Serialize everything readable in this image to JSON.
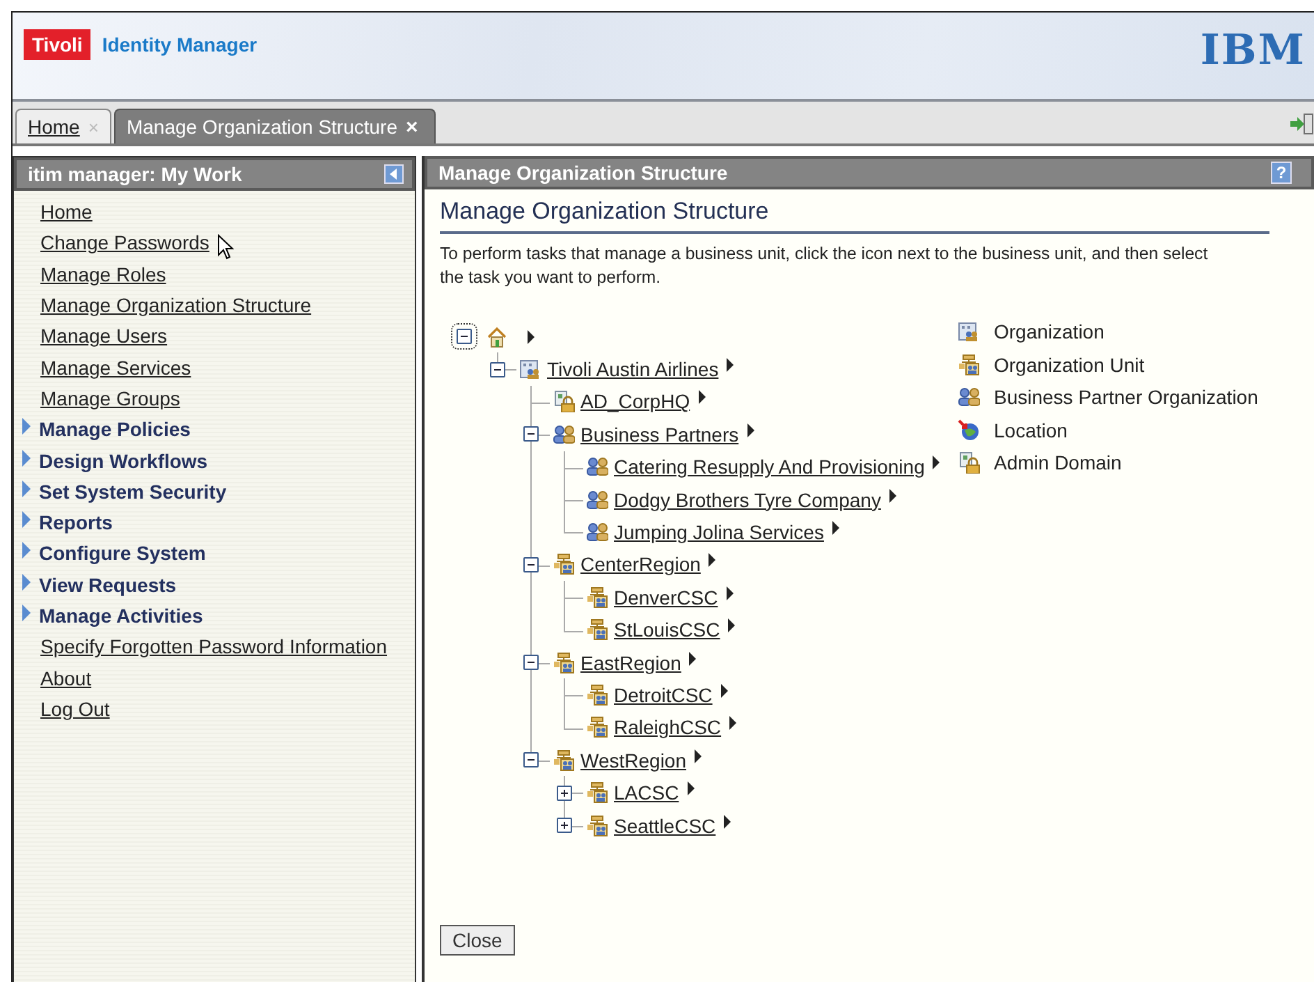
{
  "header": {
    "brand": "Tivoli",
    "product": "Identity Manager",
    "logo": "IBM"
  },
  "tabs": [
    {
      "label": "Home",
      "close": "×",
      "selected": false
    },
    {
      "label": "Manage Organization Structure",
      "close": "×",
      "selected": true
    }
  ],
  "sidebar": {
    "title": "itim manager: My Work",
    "items": [
      {
        "label": "Home",
        "kind": "link"
      },
      {
        "label": "Change Passwords",
        "kind": "link",
        "hovered": true
      },
      {
        "label": "Manage Roles",
        "kind": "link"
      },
      {
        "label": "Manage Organization Structure",
        "kind": "link"
      },
      {
        "label": "Manage Users",
        "kind": "link"
      },
      {
        "label": "Manage Services",
        "kind": "link"
      },
      {
        "label": "Manage Groups",
        "kind": "link"
      },
      {
        "label": "Manage Policies",
        "kind": "group",
        "expanded": false
      },
      {
        "label": "Design Workflows",
        "kind": "group",
        "expanded": false
      },
      {
        "label": "Set System Security",
        "kind": "group",
        "expanded": false
      },
      {
        "label": "Reports",
        "kind": "group",
        "expanded": false
      },
      {
        "label": "Configure System",
        "kind": "group",
        "expanded": false
      },
      {
        "label": "View Requests",
        "kind": "group",
        "expanded": false
      },
      {
        "label": "Manage Activities",
        "kind": "group",
        "expanded": false
      },
      {
        "label": "Specify Forgotten Password Information",
        "kind": "link"
      },
      {
        "label": "About",
        "kind": "link"
      },
      {
        "label": "Log Out",
        "kind": "link"
      }
    ]
  },
  "main": {
    "panel_title": "Manage Organization Structure",
    "help": "?",
    "heading": "Manage Organization Structure",
    "description": "To perform tasks that manage a business unit, click the icon next to the business unit, and then select the task you want to perform.",
    "tree": [
      {
        "kind": "root",
        "expanded": true,
        "children": [
          {
            "label": "Tivoli Austin Airlines",
            "kind": "organization",
            "expanded": true,
            "children": [
              {
                "label": "AD_CorpHQ",
                "kind": "admin_domain"
              },
              {
                "label": "Business Partners",
                "kind": "bp_org",
                "expanded": true,
                "children": [
                  {
                    "label": "Catering Resupply And Provisioning",
                    "kind": "bp_org"
                  },
                  {
                    "label": "Dodgy Brothers Tyre Company",
                    "kind": "bp_org"
                  },
                  {
                    "label": "Jumping Jolina Services",
                    "kind": "bp_org"
                  }
                ]
              },
              {
                "label": "CenterRegion",
                "kind": "org_unit",
                "expanded": true,
                "children": [
                  {
                    "label": "DenverCSC",
                    "kind": "org_unit"
                  },
                  {
                    "label": "StLouisCSC",
                    "kind": "org_unit"
                  }
                ]
              },
              {
                "label": "EastRegion",
                "kind": "org_unit",
                "expanded": true,
                "children": [
                  {
                    "label": "DetroitCSC",
                    "kind": "org_unit"
                  },
                  {
                    "label": "RaleighCSC",
                    "kind": "org_unit"
                  }
                ]
              },
              {
                "label": "WestRegion",
                "kind": "org_unit",
                "expanded": true,
                "children": [
                  {
                    "label": "LACSC",
                    "kind": "org_unit",
                    "expanded": false
                  },
                  {
                    "label": "SeattleCSC",
                    "kind": "org_unit",
                    "expanded": false
                  }
                ]
              }
            ]
          }
        ]
      }
    ],
    "legend": [
      {
        "label": "Organization",
        "kind": "organization"
      },
      {
        "label": "Organization Unit",
        "kind": "org_unit"
      },
      {
        "label": "Business Partner Organization",
        "kind": "bp_org"
      },
      {
        "label": "Location",
        "kind": "location"
      },
      {
        "label": "Admin Domain",
        "kind": "admin_domain"
      }
    ],
    "close_button": "Close"
  }
}
